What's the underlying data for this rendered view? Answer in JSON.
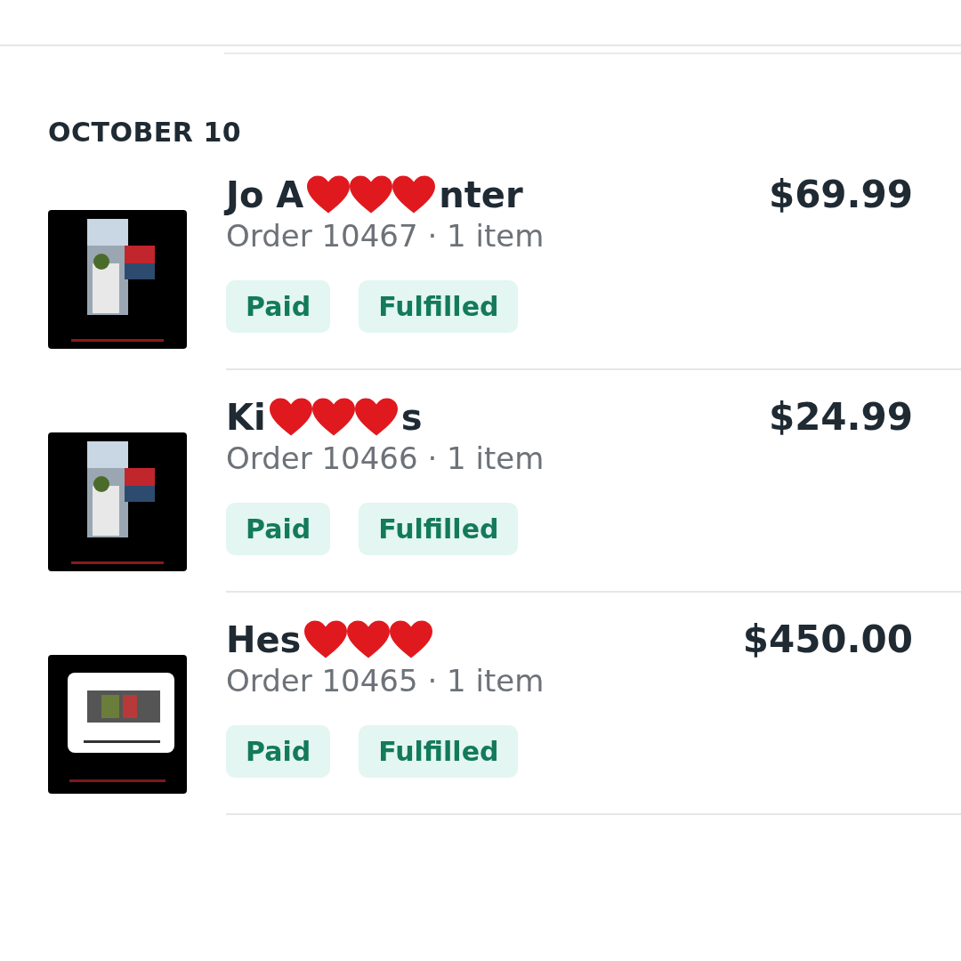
{
  "section": {
    "heading": "OCTOBER 10"
  },
  "orders": [
    {
      "thumbnail": {
        "kind": "picture"
      },
      "name_parts": [
        "Jo A",
        "nter"
      ],
      "stickers": [
        {
          "kind": "heart"
        },
        {
          "kind": "heart"
        },
        {
          "kind": "heart"
        }
      ],
      "price": "$69.99",
      "summary": "Order 10467 · 1 item",
      "badges": [
        "Paid",
        "Fulfilled"
      ]
    },
    {
      "thumbnail": {
        "kind": "picture"
      },
      "name_parts": [
        "Ki",
        "s"
      ],
      "stickers": [
        {
          "kind": "heart"
        },
        {
          "kind": "heart"
        },
        {
          "kind": "heart"
        }
      ],
      "price": "$24.99",
      "summary": "Order 10466 · 1 item",
      "badges": [
        "Paid",
        "Fulfilled"
      ]
    },
    {
      "thumbnail": {
        "kind": "picture"
      },
      "name_parts": [
        "Hes"
      ],
      "stickers": [
        {
          "kind": "heart"
        },
        {
          "kind": "heart"
        },
        {
          "kind": "heart"
        }
      ],
      "price": "$450.00",
      "summary": "Order 10465 · 1 item",
      "badges": [
        "Paid",
        "Fulfilled"
      ]
    }
  ]
}
